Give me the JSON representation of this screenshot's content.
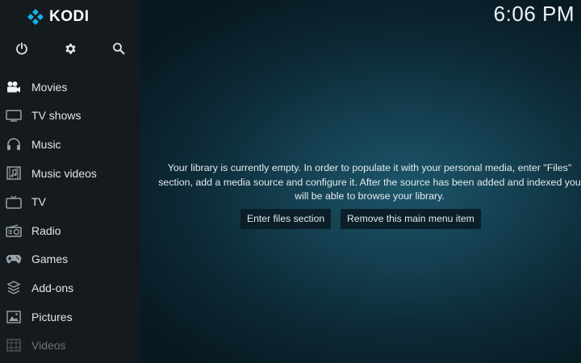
{
  "app": {
    "logo_text": "KODI",
    "clock": "6:06 PM"
  },
  "top_icons": [
    {
      "name": "power-icon"
    },
    {
      "name": "gear-icon"
    },
    {
      "name": "search-icon"
    }
  ],
  "menu": {
    "items": [
      {
        "label": "Movies",
        "icon": "movies-icon"
      },
      {
        "label": "TV shows",
        "icon": "tv-shows-icon"
      },
      {
        "label": "Music",
        "icon": "headphones-icon"
      },
      {
        "label": "Music videos",
        "icon": "music-videos-icon"
      },
      {
        "label": "TV",
        "icon": "tv-icon"
      },
      {
        "label": "Radio",
        "icon": "radio-icon"
      },
      {
        "label": "Games",
        "icon": "gamepad-icon"
      },
      {
        "label": "Add-ons",
        "icon": "addons-icon"
      },
      {
        "label": "Pictures",
        "icon": "pictures-icon"
      },
      {
        "label": "Videos",
        "icon": "videos-icon"
      }
    ]
  },
  "main": {
    "message": "Your library is currently empty. In order to populate it with your personal media, enter \"Files\" section, add a media source and configure it. After the source has been added and indexed you will be able to browse your library.",
    "enter_files_label": "Enter files section",
    "remove_item_label": "Remove this main menu item"
  },
  "colors": {
    "accent": "#12b2e7",
    "sidebar_bg": "#141a1e",
    "button_bg": "#0a1f28"
  }
}
